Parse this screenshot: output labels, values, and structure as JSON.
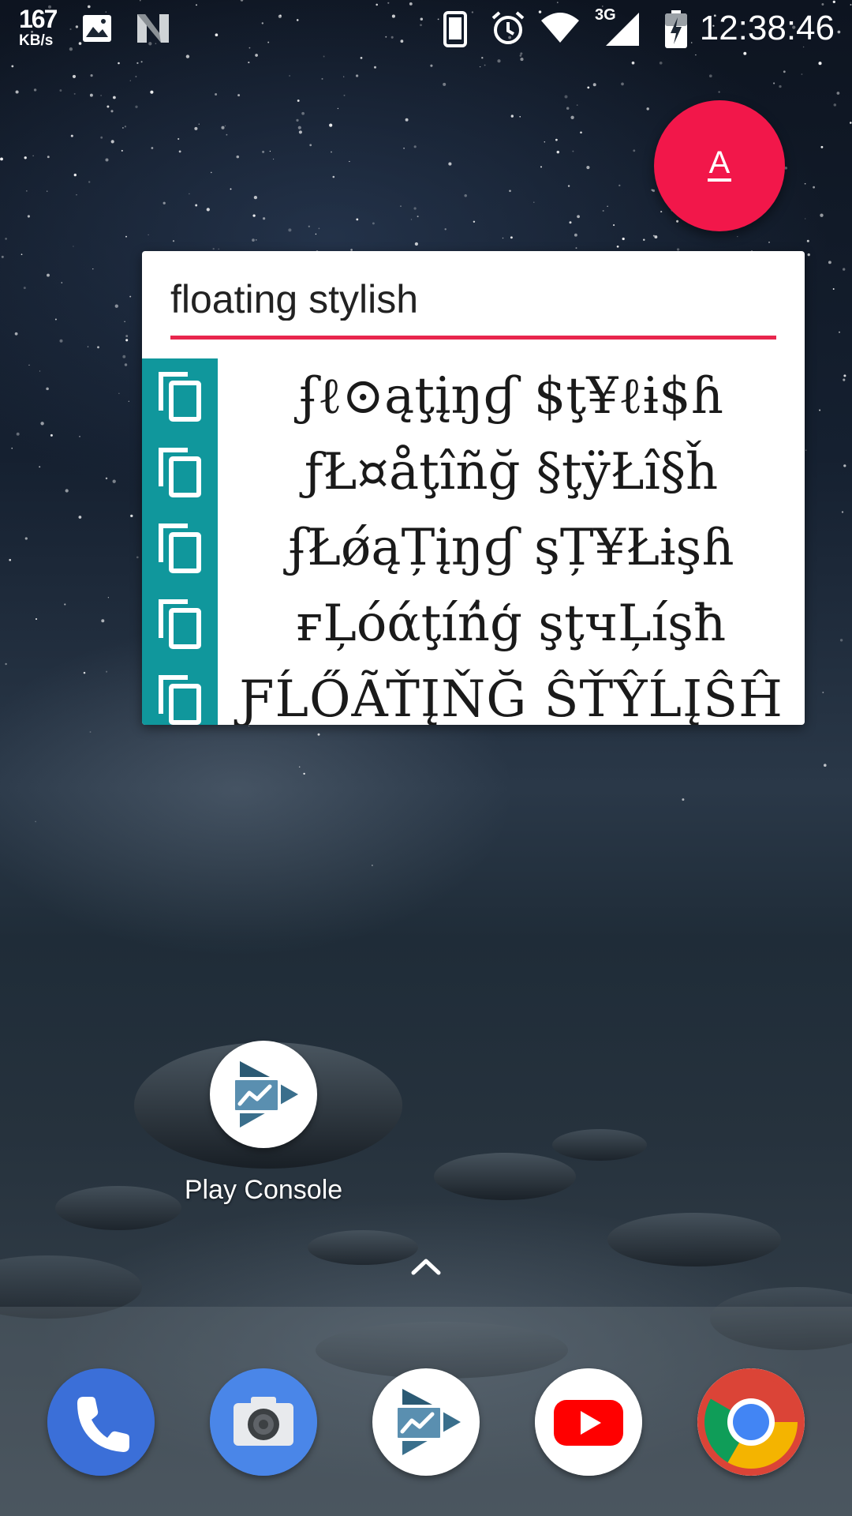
{
  "status_bar": {
    "net_speed_value": "167",
    "net_speed_unit": "KB/s",
    "network_type": "3G",
    "time": "12:38:46",
    "left_icons": [
      "image-icon",
      "n-notification-icon"
    ],
    "right_icons": [
      "phone-portrait-icon",
      "alarm-icon",
      "wifi-icon",
      "cell-signal-icon",
      "battery-charging-icon"
    ]
  },
  "fab": {
    "label": "A",
    "color": "#f2174a"
  },
  "panel": {
    "search": {
      "value": "floating stylish",
      "underline_color": "#e8264d"
    },
    "copy_column_color": "#10979c",
    "results": [
      {
        "text": "ʄℓ⊙ąţįŋɠ $ţ¥ℓɨ$ɦ"
      },
      {
        "text": "ƒŁ¤åţîñğ §ţÿŁî§ȟ"
      },
      {
        "text": "ʄŁǿąȚįŋɠ şȚ¥Łɨşɦ"
      },
      {
        "text": "ғĻóάţíń̍ģ şţчĻíşħ"
      },
      {
        "text": "ƑĹŐÃŤĮŇĞ ŜŤŶĹĮŜĤ"
      }
    ]
  },
  "home": {
    "app": {
      "label": "Play Console",
      "icon": "play-console-icon"
    }
  },
  "dock": {
    "apps": [
      {
        "name": "Phone",
        "icon": "phone-icon",
        "color": "#3b6fd8"
      },
      {
        "name": "Camera",
        "icon": "camera-icon",
        "color": "#4a86e8"
      },
      {
        "name": "Play Console",
        "icon": "play-console-icon",
        "color": "#ffffff"
      },
      {
        "name": "YouTube",
        "icon": "youtube-icon",
        "color": "#ff0000"
      },
      {
        "name": "Chrome",
        "icon": "chrome-icon",
        "color": "#4285f4"
      }
    ]
  }
}
